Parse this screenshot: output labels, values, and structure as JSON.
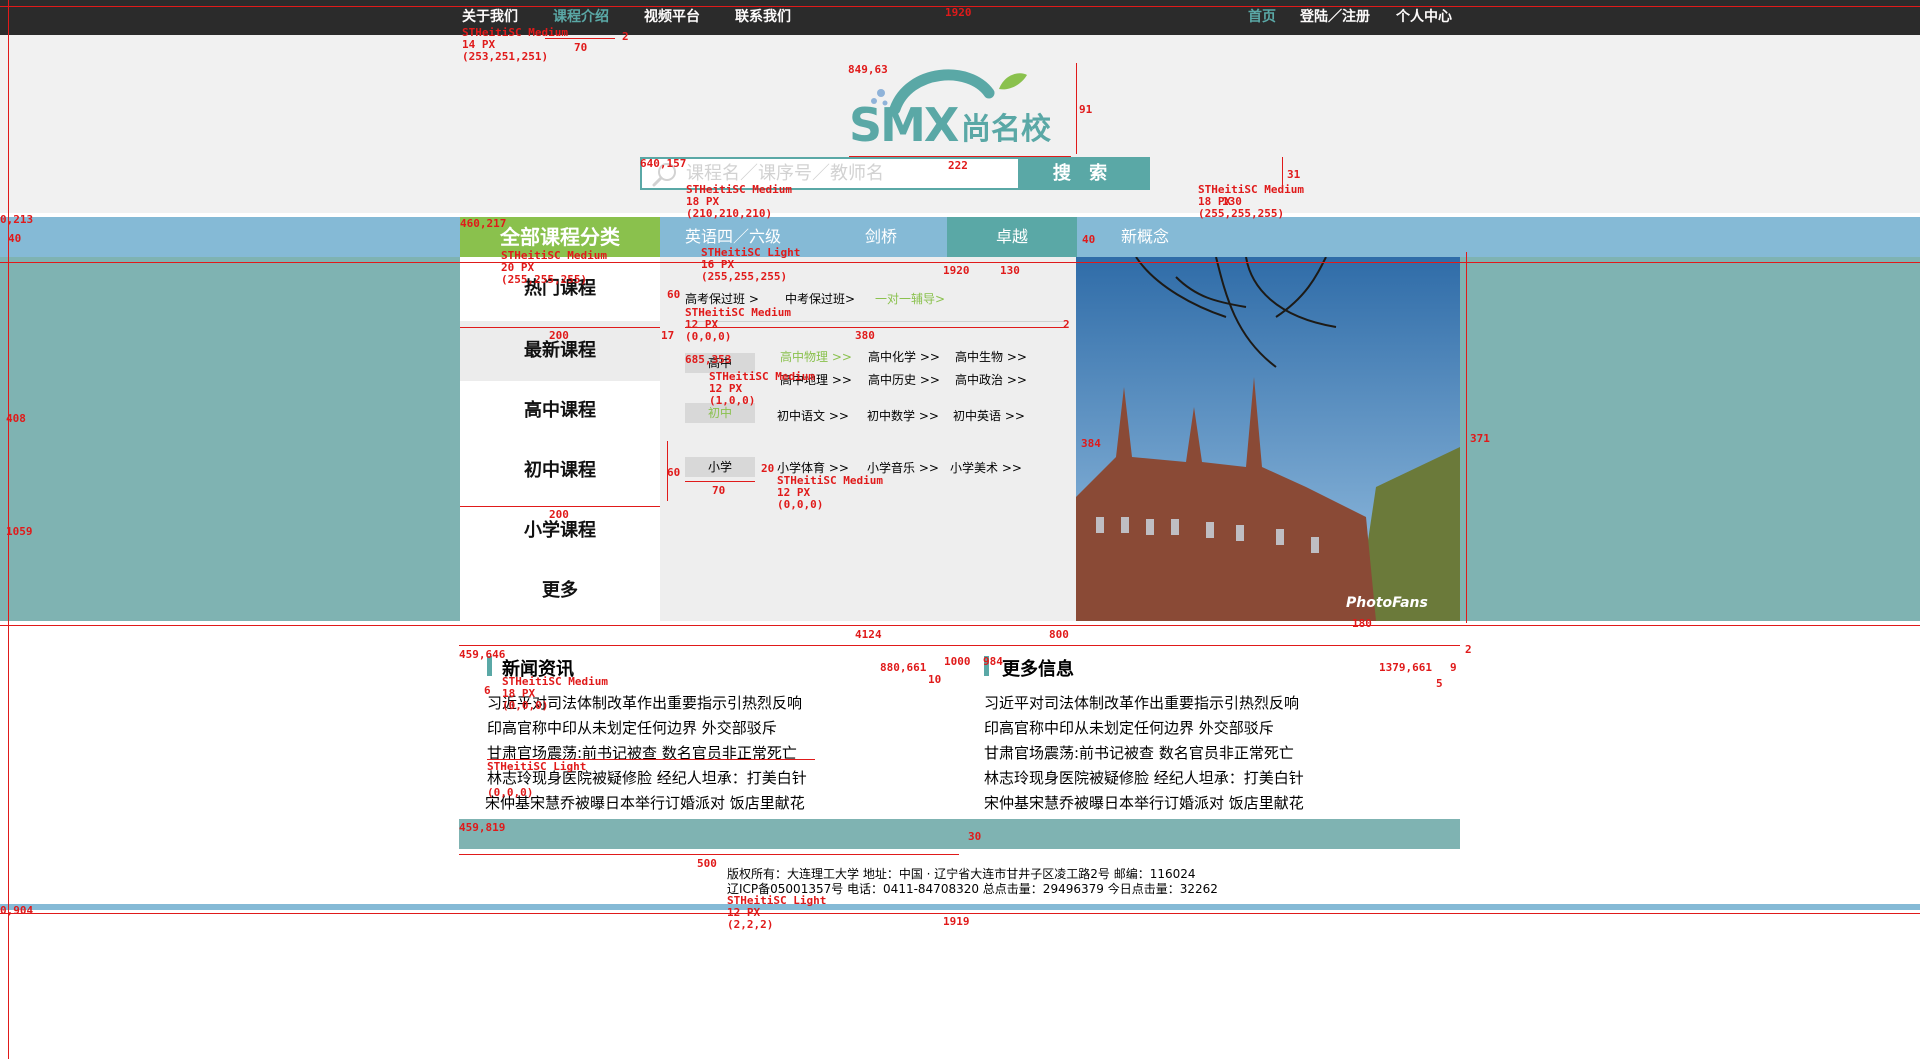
{
  "top_nav": {
    "left": [
      "关于我们",
      "课程介绍",
      "视频平台",
      "联系我们"
    ],
    "active_left": "课程介绍",
    "right": [
      "首页",
      "登陆／注册",
      "个人中心"
    ],
    "active_right": "首页"
  },
  "logo": {
    "letters": "SMX",
    "name": "尚名校"
  },
  "search": {
    "placeholder": "课程名／课序号／教师名",
    "button": "搜 索"
  },
  "nav": {
    "all_categories": "全部课程分类",
    "tabs": [
      "英语四／六级",
      "剑桥",
      "卓越",
      "新概念"
    ],
    "active_tab": "卓越"
  },
  "left_menu": [
    "热门课程",
    "最新课程",
    "高中课程",
    "初中课程",
    "小学课程",
    "更多"
  ],
  "sub_panel": {
    "top_links": [
      "高考保过班 >",
      "中考保过班>",
      "一对一辅导>"
    ],
    "high_school": {
      "label": "高中",
      "items": [
        "高中物理 >>",
        "高中化学 >>",
        "高中生物 >>",
        "高中地理 >>",
        "高中历史 >>",
        "高中政治 >>"
      ]
    },
    "middle_school": {
      "label": "初中",
      "items": [
        "初中语文 >>",
        "初中数学 >>",
        "初中英语 >>"
      ]
    },
    "primary": {
      "label": "小学",
      "items": [
        "小学体育 >>",
        "小学音乐 >>",
        "小学美术 >>"
      ]
    }
  },
  "photo_caption": "PhotoFans",
  "news": {
    "left_title": "新闻资讯",
    "right_title": "更多信息",
    "items": [
      "习近平对司法体制改革作出重要指示引热烈反响",
      "印高官称中印从未划定任何边界 外交部驳斥",
      "甘肃官场震荡:前书记被查 数名官员非正常死亡",
      "林志玲现身医院被疑修脸 经纪人坦承：打美白针",
      "宋仲基宋慧乔被曝日本举行订婚派对 饭店里献花"
    ]
  },
  "footer": {
    "line1": "版权所有：大连理工大学  地址：中国 · 辽宁省大连市甘井子区凌工路2号  邮编：116024",
    "line2": "辽ICP备05001357号  电话：0411-84708320 总点击量：29496379 今日点击量：32262"
  },
  "annotations": {
    "width_1920": "1920",
    "top_font": "STHeitiSC Medium",
    "top_size": "14 PX",
    "top_color": "(253,251,251)",
    "tab_w": "70",
    "tab_gap": "2",
    "logo_pos": "849,63",
    "logo_h": "91",
    "logo_w": "222",
    "search_pos": "640,157",
    "search_font": "STHeitiSC Medium",
    "search_size": "18 PX",
    "search_color": "(210,210,210)",
    "search_h": "31",
    "btn_font": "STHeitiSC Medium",
    "btn_size": "18 PX",
    "btn_w": "130",
    "btn_color": "(255,255,255)",
    "nav_y": "0,213",
    "nav_h": "40",
    "cat_pos": "460,217",
    "cat_font": "STHeitiSC Medium",
    "cat_size": "20 PX",
    "cat_color": "(255,255,255)",
    "tab_font": "STHeitiSC Light",
    "tab_size": "16 PX",
    "tab_color": "(255,255,255)",
    "nav_w": "1920",
    "tab_w130": "130",
    "nav_h2": "40",
    "sub_h60": "60",
    "sub_font": "STHeitiSC Medium",
    "sub_size": "12 PX",
    "sub_color": "(0,0,0)",
    "menu_w200": "200",
    "sub_17": "17",
    "sub_380": "380",
    "sub_2": "2",
    "chip_pos": "685,353",
    "chip_font": "STHeitiSC Medium",
    "chip_size": "12 PX",
    "chip_color": "(1,0,0)",
    "band_h408": "408",
    "band_1059": "1059",
    "chip_60": "60",
    "chip_20": "20",
    "chip_70": "70",
    "prim_font": "STHeitiSC Medium",
    "prim_size": "12 PX",
    "prim_color": "(0,0,0)",
    "menu_200b": "200",
    "photo_371": "371",
    "photo_384": "384",
    "photo_180": "180",
    "w_412": "412",
    "w_4": "4",
    "w_800": "800",
    "news_pos": "459,646",
    "news_font": "STHeitiSC Medium",
    "news_size": "18 PX",
    "news_color": "(0,0,0)",
    "news_6": "6",
    "more_pos": "880,661",
    "more_10": "10",
    "w_1000": "1000",
    "n_984": "984",
    "more_pos2": "1379,661",
    "more_5": "5",
    "more_9": "9",
    "r_2": "2",
    "item_font": "STHeitiSC Light",
    "item_color": "(0,0,0)",
    "foot_pos": "459,819",
    "foot_30": "30",
    "foot_500": "500",
    "foot_font": "STHeitiSC Light",
    "foot_size": "12 PX",
    "foot_color": "(2,2,2)",
    "foot_1919": "1919",
    "bottom_y": "0,904"
  },
  "colors": {
    "teal": "#5aa8a6",
    "green": "#8ac14d",
    "lightblue": "#85bad6",
    "band": "#7fb3b2",
    "dark": "#2b2b2b",
    "annotation": "#e01a1a"
  }
}
